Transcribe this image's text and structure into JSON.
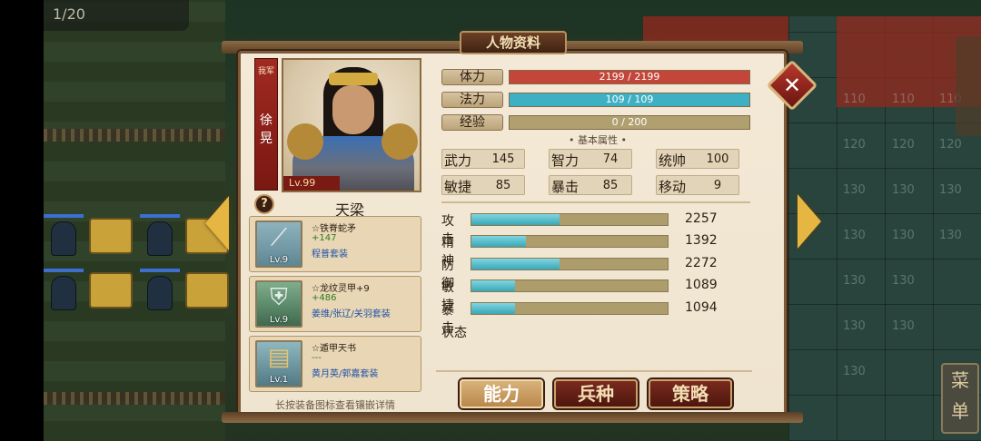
{
  "hud": {
    "turn": "1/20",
    "menu_label": "菜单"
  },
  "panel": {
    "title": "人物资料",
    "close_glyph": "✕"
  },
  "general": {
    "faction": "我军",
    "name": "徐晃",
    "level": "Lv.99",
    "unit_type": "天梁"
  },
  "bars": [
    {
      "label": "体力",
      "value": "2199 / 2199",
      "fraction": 1.0,
      "color": "#c4463a"
    },
    {
      "label": "法力",
      "value": "109 / 109",
      "fraction": 1.0,
      "color": "#3eb0c4"
    },
    {
      "label": "经验",
      "value": "0 / 200",
      "fraction": 0.0,
      "color": "#9a8a5c"
    }
  ],
  "basic_section_title": "基本属性",
  "attributes": [
    {
      "label": "武力",
      "value": "145"
    },
    {
      "label": "智力",
      "value": "74"
    },
    {
      "label": "统帅",
      "value": "100"
    },
    {
      "label": "敏捷",
      "value": "85"
    },
    {
      "label": "暴击",
      "value": "85"
    },
    {
      "label": "移动",
      "value": "9"
    }
  ],
  "combat": [
    {
      "label": "攻击",
      "value": "2257",
      "fraction": 0.45
    },
    {
      "label": "精神",
      "value": "1392",
      "fraction": 0.28
    },
    {
      "label": "防御",
      "value": "2272",
      "fraction": 0.45
    },
    {
      "label": "敏捷",
      "value": "1089",
      "fraction": 0.22
    },
    {
      "label": "暴击",
      "value": "1094",
      "fraction": 0.22
    }
  ],
  "state_label": "状态",
  "equipment": [
    {
      "name": "☆铁脊蛇矛",
      "bonus": "+147",
      "set": "程普套装",
      "level": "Lv.9",
      "icon": "spear-icon"
    },
    {
      "name": "☆龙纹灵甲+9",
      "bonus": "+486",
      "set": "姜维/张辽/关羽套装",
      "level": "Lv.9",
      "icon": "armor-icon"
    },
    {
      "name": "☆遁甲天书",
      "bonus": "---",
      "set": "黄月英/郭嘉套装",
      "level": "Lv.1",
      "icon": "scroll-icon"
    }
  ],
  "hint": "长按装备图标查看镶嵌详情",
  "tabs": [
    {
      "label": "能力",
      "active": true
    },
    {
      "label": "兵种",
      "active": false
    },
    {
      "label": "策略",
      "active": false
    }
  ]
}
